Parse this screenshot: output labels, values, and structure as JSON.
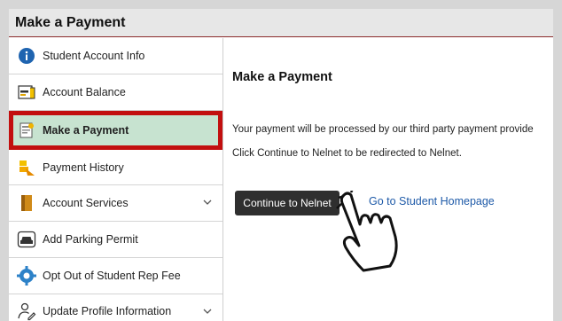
{
  "window": {
    "title": "Make a Payment"
  },
  "sidebar": {
    "items": [
      {
        "label": "Student Account Info",
        "icon": "info-icon"
      },
      {
        "label": "Account Balance",
        "icon": "balance-icon"
      },
      {
        "label": "Make a Payment",
        "icon": "payment-icon",
        "active": true
      },
      {
        "label": "Payment History",
        "icon": "history-icon"
      },
      {
        "label": "Account Services",
        "icon": "book-icon",
        "expandable": true
      },
      {
        "label": "Add Parking Permit",
        "icon": "car-icon"
      },
      {
        "label": "Opt Out of Student Rep Fee",
        "icon": "gear-icon"
      },
      {
        "label": "Update Profile Information",
        "icon": "user-edit-icon",
        "expandable": true
      }
    ]
  },
  "main": {
    "title": "Make a Payment",
    "message_1": "Your payment will be processed by our third party payment provide",
    "message_2": "Click Continue to Nelnet to be redirected to Nelnet.",
    "continue_label": "Continue to Nelnet",
    "home_link": "Go to Student Homepage"
  },
  "colors": {
    "highlight_border": "#c20f0f",
    "active_bg": "#c7e3d0",
    "button_bg": "#2f2f2f",
    "link": "#1e5aa8"
  }
}
